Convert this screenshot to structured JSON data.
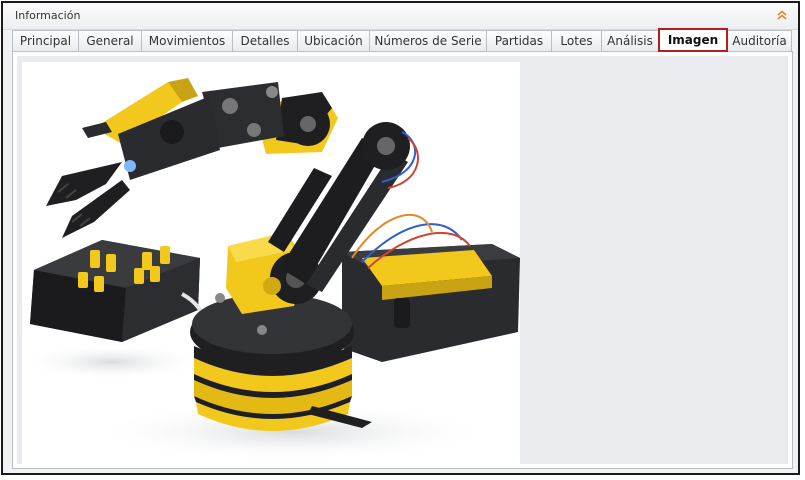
{
  "panel": {
    "title": "Información",
    "collapse_icon": "chevron-up-icon"
  },
  "tabs": [
    {
      "label": "Principal",
      "active": false
    },
    {
      "label": "General",
      "active": false
    },
    {
      "label": "Movimientos",
      "active": false
    },
    {
      "label": "Detalles",
      "active": false
    },
    {
      "label": "Ubicación",
      "active": false
    },
    {
      "label": "Números de Serie",
      "active": false
    },
    {
      "label": "Partidas",
      "active": false
    },
    {
      "label": "Lotes",
      "active": false
    },
    {
      "label": "Análisis",
      "active": false
    },
    {
      "label": "Imagen",
      "active": true
    },
    {
      "label": "Auditoría",
      "active": false
    }
  ],
  "image": {
    "subject": "robotic-arm-kit-photo"
  },
  "colors": {
    "accent_highlight": "#b11f1f",
    "robot_yellow": "#f2c81c",
    "robot_black": "#1f1f22"
  }
}
